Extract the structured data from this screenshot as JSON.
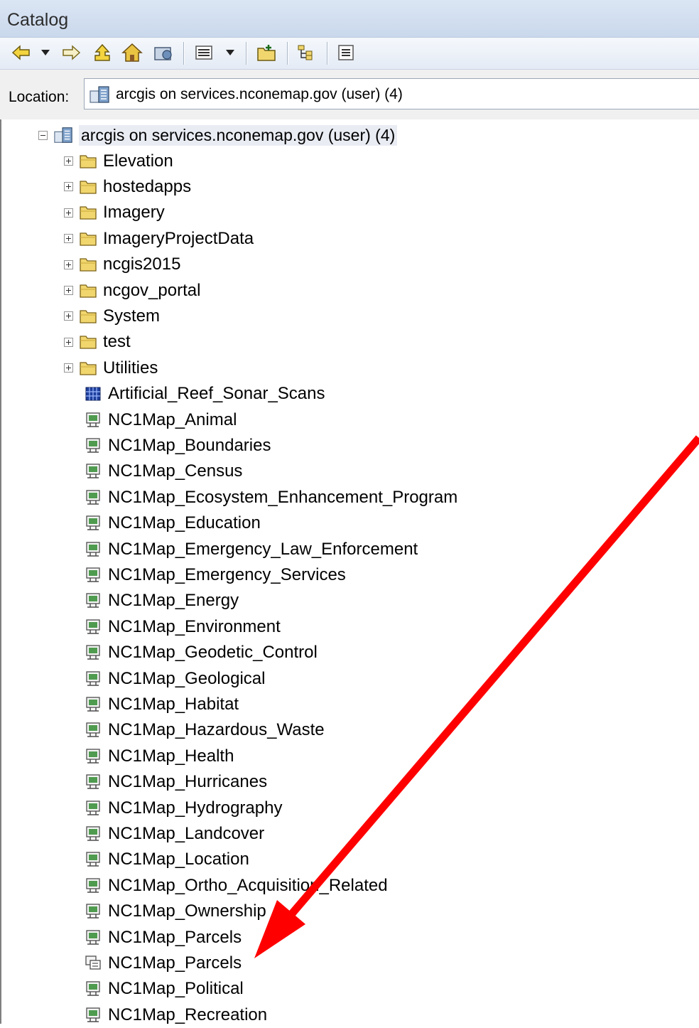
{
  "window": {
    "title": "Catalog"
  },
  "toolbar": {
    "buttons": [
      {
        "name": "back-icon"
      },
      {
        "name": "dropdown-arrow-icon"
      },
      {
        "name": "forward-icon"
      },
      {
        "name": "up-one-level-icon"
      },
      {
        "name": "home-icon"
      },
      {
        "name": "connect-folder-icon"
      },
      {
        "name": "views-icon"
      },
      {
        "name": "views-dropdown-icon"
      },
      {
        "name": "new-folder-icon"
      },
      {
        "name": "toggle-tree-icon"
      },
      {
        "name": "options-icon"
      }
    ]
  },
  "location": {
    "label": "Location:",
    "value": "arcgis on services.nconemap.gov (user) (4)",
    "icon": "server-connection-icon"
  },
  "tree": {
    "root": {
      "label": "arcgis on services.nconemap.gov (user) (4)",
      "expanded": true,
      "icon": "server-connection-icon"
    },
    "folders": [
      "Elevation",
      "hostedapps",
      "Imagery",
      "ImageryProjectData",
      "ncgis2015",
      "ncgov_portal",
      "System",
      "test",
      "Utilities"
    ],
    "image_services": [
      "Artificial_Reef_Sonar_Scans"
    ],
    "services": [
      {
        "label": "NC1Map_Animal",
        "kind": "map"
      },
      {
        "label": "NC1Map_Boundaries",
        "kind": "map"
      },
      {
        "label": "NC1Map_Census",
        "kind": "map"
      },
      {
        "label": "NC1Map_Ecosystem_Enhancement_Program",
        "kind": "map"
      },
      {
        "label": "NC1Map_Education",
        "kind": "map"
      },
      {
        "label": "NC1Map_Emergency_Law_Enforcement",
        "kind": "map"
      },
      {
        "label": "NC1Map_Emergency_Services",
        "kind": "map"
      },
      {
        "label": "NC1Map_Energy",
        "kind": "map"
      },
      {
        "label": "NC1Map_Environment",
        "kind": "map"
      },
      {
        "label": "NC1Map_Geodetic_Control",
        "kind": "map"
      },
      {
        "label": "NC1Map_Geological",
        "kind": "map"
      },
      {
        "label": "NC1Map_Habitat",
        "kind": "map"
      },
      {
        "label": "NC1Map_Hazardous_Waste",
        "kind": "map"
      },
      {
        "label": "NC1Map_Health",
        "kind": "map"
      },
      {
        "label": "NC1Map_Hurricanes",
        "kind": "map"
      },
      {
        "label": "NC1Map_Hydrography",
        "kind": "map"
      },
      {
        "label": "NC1Map_Landcover",
        "kind": "map"
      },
      {
        "label": "NC1Map_Location",
        "kind": "map"
      },
      {
        "label": "NC1Map_Ortho_Acquisition_Related",
        "kind": "map"
      },
      {
        "label": "NC1Map_Ownership",
        "kind": "map"
      },
      {
        "label": "NC1Map_Parcels",
        "kind": "map"
      },
      {
        "label": "NC1Map_Parcels",
        "kind": "feature"
      },
      {
        "label": "NC1Map_Political",
        "kind": "map"
      },
      {
        "label": "NC1Map_Recreation",
        "kind": "map"
      }
    ]
  },
  "annotation": {
    "color": "#ff0000",
    "target": "NC1Map_Parcels (feature)"
  },
  "colors": {
    "titlebar": "#cad8ec",
    "folder": "#f1d66e",
    "selection": "#e9ecf3"
  }
}
